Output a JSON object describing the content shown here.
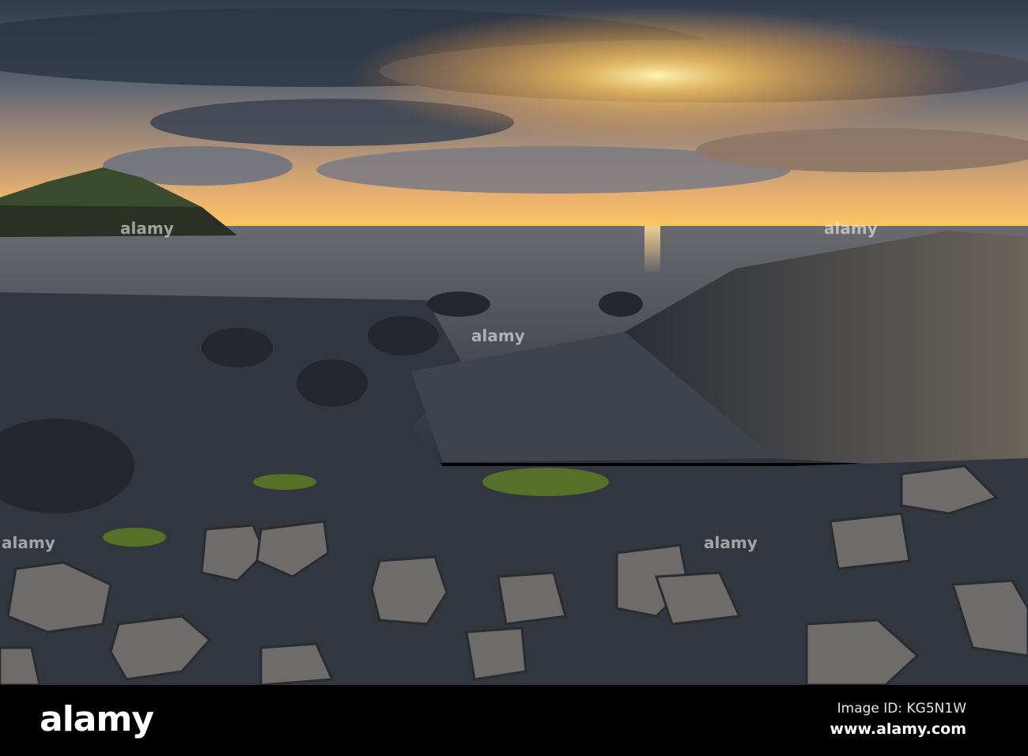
{
  "image": {
    "subject": "sunset-over-basalt-columns-coast",
    "colors": {
      "sky_dark": "#3a4656",
      "sun": "#ffd070",
      "sea": "#4a4e58",
      "rock": "#3c4048",
      "moss": "#6a8a2a"
    }
  },
  "watermark": {
    "logo": "alamy",
    "image_id": "Image ID: KG5N1W",
    "site": "www.alamy.com"
  }
}
